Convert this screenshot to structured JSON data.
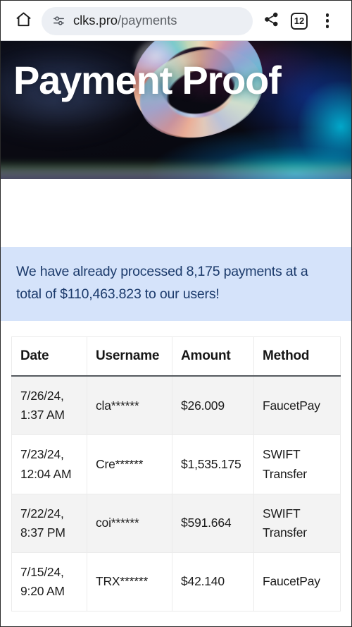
{
  "browser": {
    "home_icon": "home-icon",
    "omnibox": {
      "tune_icon": "page-info-tune-icon",
      "url_host": "clks.pro",
      "url_path": "/payments",
      "url_full": "clks.pro/payments"
    },
    "share_icon": "share-icon",
    "tab_count": "12",
    "menu_icon": "overflow-menu-icon"
  },
  "hero": {
    "title": "Payment Proof"
  },
  "alert": {
    "text": "We have already processed 8,175 payments at a total of $110,463.823 to our users!",
    "bg_color": "#d5e3fa",
    "text_color": "#1b3a6b",
    "payments_count": "8,175",
    "total_amount": "$110,463.823"
  },
  "table": {
    "headers": [
      "Date",
      "Username",
      "Amount",
      "Method"
    ],
    "rows": [
      {
        "date": "7/26/24, 1:37 AM",
        "username": "cla******",
        "amount": "$26.009",
        "method": "FaucetPay"
      },
      {
        "date": "7/23/24, 12:04 AM",
        "username": "Cre******",
        "amount": "$1,535.175",
        "method": "SWIFT Transfer"
      },
      {
        "date": "7/22/24, 8:37 PM",
        "username": "coi******",
        "amount": "$591.664",
        "method": "SWIFT Transfer"
      },
      {
        "date": "7/15/24, 9:20 AM",
        "username": "TRX******",
        "amount": "$42.140",
        "method": "FaucetPay"
      }
    ]
  }
}
